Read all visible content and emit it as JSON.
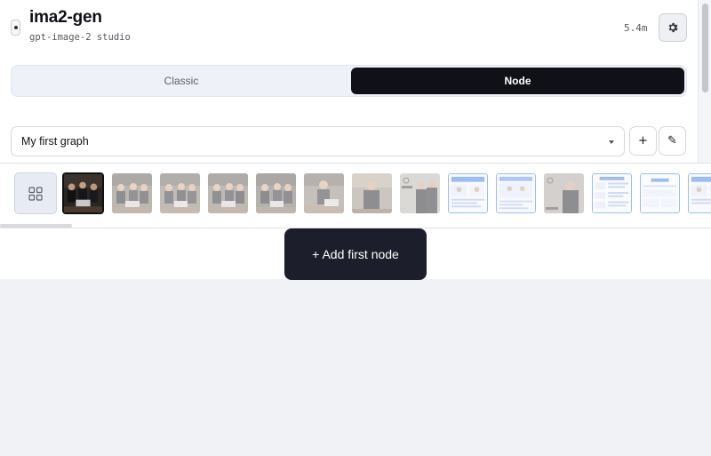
{
  "app": {
    "title": "ima2-gen",
    "subtitle": "gpt-image-2 studio",
    "elapsed": "5.4m"
  },
  "icons": {
    "settings": "gear-icon",
    "grid": "grid-view-icon",
    "status": "status-dot-icon",
    "rename": "pencil-icon"
  },
  "mode_toggle": {
    "tabs": [
      {
        "label": "Classic",
        "active": false
      },
      {
        "label": "Node",
        "active": true
      }
    ]
  },
  "graph": {
    "selected": "My first graph",
    "add_label": "+",
    "rename_label": "✎"
  },
  "history": {
    "thumbnails": [
      {
        "kind": "photo-group-dark",
        "active": true
      },
      {
        "kind": "photo-group-office",
        "active": false
      },
      {
        "kind": "photo-group-office",
        "active": false
      },
      {
        "kind": "photo-group-office",
        "active": false
      },
      {
        "kind": "photo-group-office",
        "active": false
      },
      {
        "kind": "photo-person-laptop",
        "active": false
      },
      {
        "kind": "photo-person",
        "active": false
      },
      {
        "kind": "photo-pair-openai",
        "active": false
      },
      {
        "kind": "document-infographic",
        "active": false
      },
      {
        "kind": "document-infographic",
        "active": false
      },
      {
        "kind": "photo-pair-openai",
        "active": false
      },
      {
        "kind": "document-list",
        "active": false
      },
      {
        "kind": "document-insight",
        "active": false
      },
      {
        "kind": "document-infographic",
        "active": false
      }
    ]
  },
  "canvas": {
    "add_node_label": "+ Add first node"
  },
  "colors": {
    "accent_dark": "#0f1116",
    "button_dark": "#1c1f2b",
    "doc_blue": "#3d7be6"
  }
}
